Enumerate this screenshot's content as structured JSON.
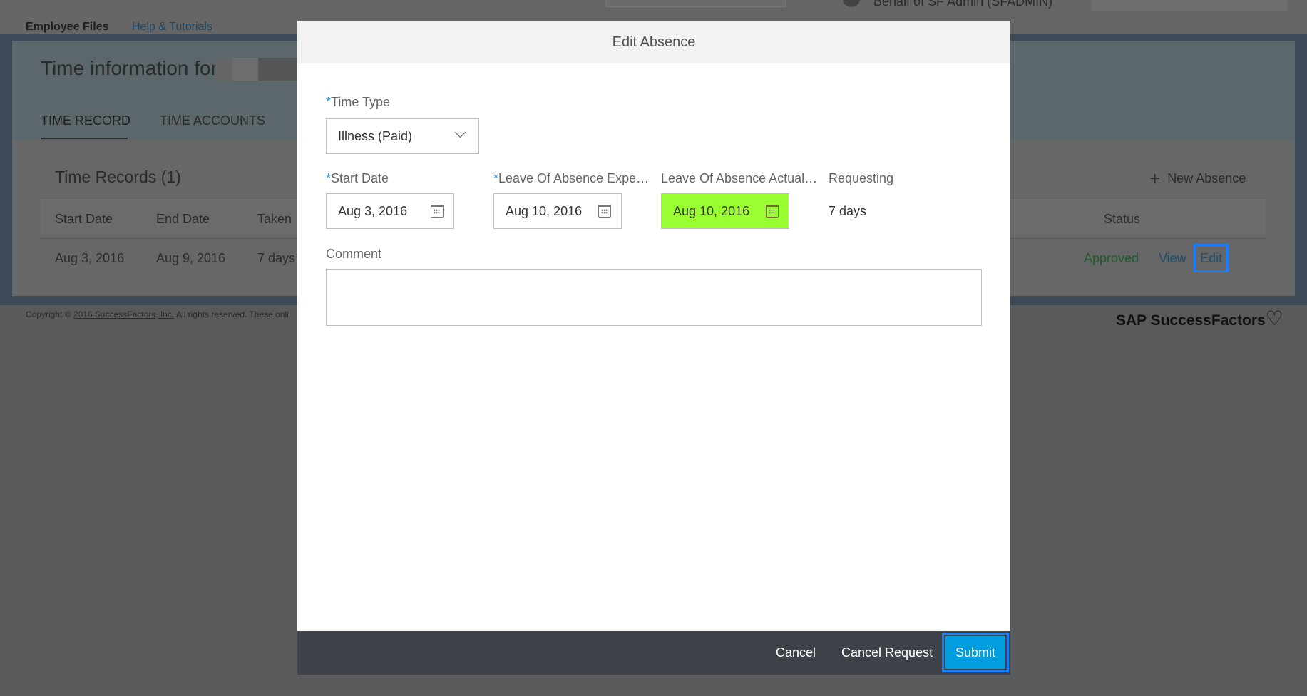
{
  "header": {
    "user_text": "Behalf of SF Admin (SFADMIN)",
    "nav": [
      "Employee Files",
      "Help & Tutorials"
    ]
  },
  "page": {
    "title": "Time information for",
    "tabs": [
      "TIME RECORD",
      "TIME ACCOUNTS"
    ],
    "records_title": "Time Records (1)",
    "new_absence": "New Absence",
    "columns": [
      "Start Date",
      "End Date",
      "Taken",
      "Status"
    ],
    "row": {
      "start": "Aug 3, 2016",
      "end": "Aug 9, 2016",
      "taken": "7 days",
      "status": "Approved",
      "view": "View",
      "edit": "Edit"
    }
  },
  "footer": {
    "copyright_prefix": "Copyright ©",
    "copyright_link": "2016 SuccessFactors, Inc.",
    "copyright_suffix": "All rights reserved. These onli",
    "brand": "SAP SuccessFactors"
  },
  "dialog": {
    "title": "Edit Absence",
    "time_type": {
      "label": "Time Type",
      "value": "Illness (Paid)"
    },
    "start_date": {
      "label": "Start Date",
      "value": "Aug 3, 2016"
    },
    "expected": {
      "label": "Leave Of Absence Expe…",
      "value": "Aug 10, 2016"
    },
    "actual": {
      "label": "Leave Of Absence Actual…",
      "value": "Aug 10, 2016",
      "highlight": "#99ff33"
    },
    "requesting": {
      "label": "Requesting",
      "value": "7 days"
    },
    "comment": {
      "label": "Comment",
      "value": ""
    },
    "buttons": {
      "cancel": "Cancel",
      "cancel_request": "Cancel Request",
      "submit": "Submit"
    }
  },
  "colors": {
    "accent": "#009de0",
    "approved": "#1e5a2e",
    "link": "#1d4f6e"
  }
}
